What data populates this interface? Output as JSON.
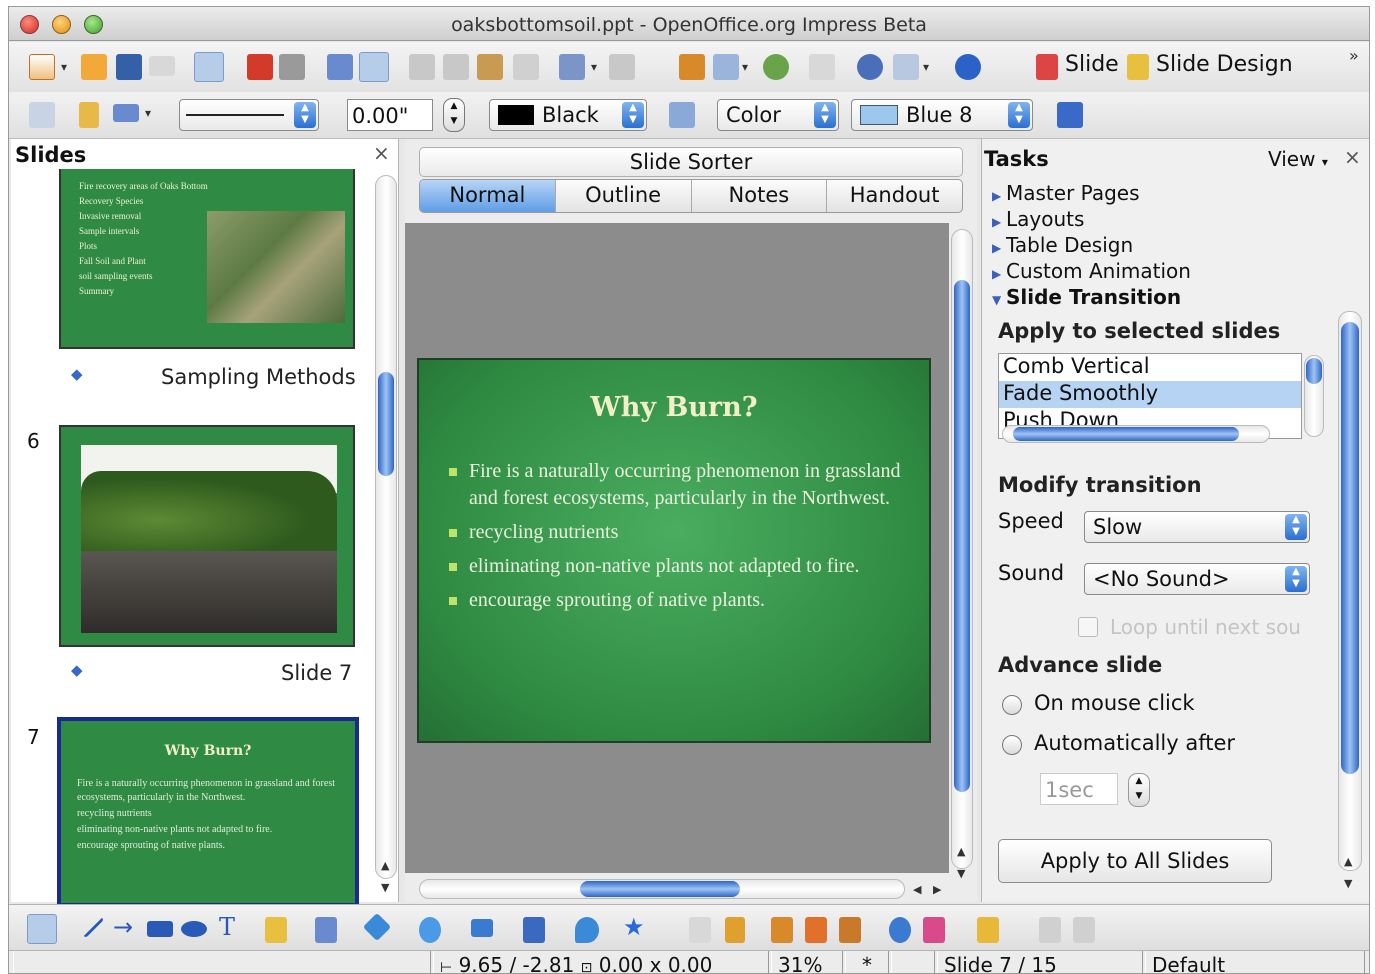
{
  "window": {
    "title": "oaksbottomsoil.ppt - OpenOffice.org Impress Beta"
  },
  "toolbar": {
    "slide_label": "Slide",
    "slide_design_label": "Slide Design",
    "more": "»"
  },
  "format_bar": {
    "line_width": "0.00\"",
    "line_color": "Black",
    "area_style": "Color",
    "area_color": "Blue 8"
  },
  "colors": {
    "line_color_swatch": "#000000",
    "area_color_swatch": "#9cc8ee",
    "slide_bg": "#2f8a43",
    "selection": "#b6d3f3"
  },
  "slides_pane": {
    "title": "Slides",
    "close": "×",
    "items": [
      {
        "number": "",
        "caption": "Sampling Methods",
        "lines": [
          "Fire recovery areas of Oaks Bottom",
          "Recovery Species",
          "Invasive removal",
          "Sample intervals",
          "Plots",
          "Fall Soil and Plant",
          "soil sampling events",
          "Summary"
        ]
      },
      {
        "number": "6",
        "caption": "Slide 7"
      },
      {
        "number": "7",
        "caption": "",
        "title": "Why Burn?",
        "lines": [
          "Fire is a naturally occurring phenomenon in grassland and forest ecosystems, particularly in the Northwest.",
          "recycling nutrients",
          "eliminating non-native plants not adapted to fire.",
          "encourage sprouting of native plants."
        ]
      }
    ]
  },
  "center": {
    "sorter_label": "Slide Sorter",
    "tabs": [
      {
        "label": "Normal",
        "active": true
      },
      {
        "label": "Outline"
      },
      {
        "label": "Notes"
      },
      {
        "label": "Handout"
      }
    ],
    "slide": {
      "title": "Why Burn?",
      "bullets": [
        "Fire is a naturally occurring phenomenon in grassland and forest ecosystems, particularly in the Northwest.",
        "recycling nutrients",
        "eliminating non-native plants not adapted to fire.",
        "encourage sprouting of native plants."
      ]
    }
  },
  "tasks": {
    "title": "Tasks",
    "view_label": "View",
    "close": "×",
    "items": [
      {
        "label": "Master Pages"
      },
      {
        "label": "Layouts"
      },
      {
        "label": "Table Design"
      },
      {
        "label": "Custom Animation"
      },
      {
        "label": "Slide Transition",
        "expanded": true
      }
    ],
    "transition": {
      "apply_heading": "Apply to selected slides",
      "list": [
        "Comb Vertical",
        "Fade Smoothly",
        "Push Down"
      ],
      "selected": "Fade Smoothly",
      "modify_heading": "Modify transition",
      "speed_label": "Speed",
      "speed_value": "Slow",
      "sound_label": "Sound",
      "sound_value": "<No Sound>",
      "loop_label": "Loop until next sou",
      "advance_heading": "Advance slide",
      "on_click_label": "On mouse click",
      "auto_label": "Automatically after",
      "auto_value": "1sec",
      "apply_all_label": "Apply to All Slides"
    }
  },
  "statusbar": {
    "position": "9.65 / -2.81",
    "size": "0.00 x 0.00",
    "zoom": "31%",
    "modified": "*",
    "slide": "Slide 7 / 15",
    "layout": "Default"
  }
}
